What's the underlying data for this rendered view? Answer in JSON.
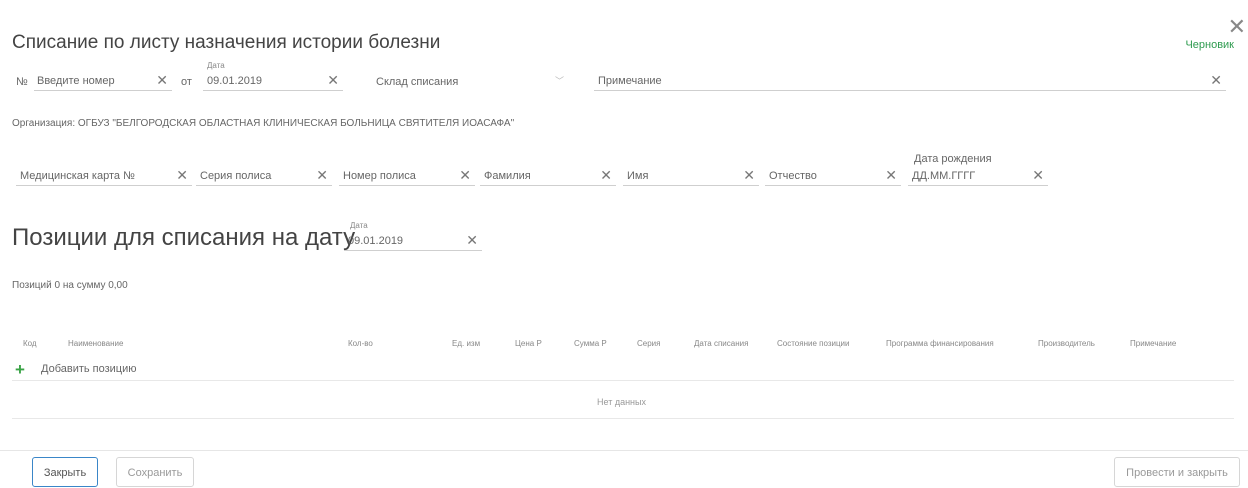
{
  "header": {
    "title": "Списание по листу назначения истории болезни",
    "status": "Черновик",
    "close_symbol": "✕"
  },
  "top_fields": {
    "number_prefix": "№",
    "number_placeholder": "Введите номер",
    "date_prefix": "от",
    "date_label": "Дата",
    "date_value": "09.01.2019",
    "warehouse_placeholder": "Склад списания",
    "note_placeholder": "Примечание",
    "clear_symbol": "✕"
  },
  "organization": "Организация: ОГБУЗ \"БЕЛГОРОДСКАЯ ОБЛАСТНАЯ КЛИНИЧЕСКАЯ БОЛЬНИЦА СВЯТИТЕЛЯ ИОАСАФА\"",
  "patient_fields": {
    "card": "Медицинская карта №",
    "policy_series": "Серия полиса",
    "policy_number": "Номер полиса",
    "last_name": "Фамилия",
    "first_name": "Имя",
    "middle_name": "Отчество",
    "birth_label": "Дата рождения",
    "birth_placeholder": "ДД.ММ.ГГГГ"
  },
  "positions": {
    "title": "Позиции для списания на дату",
    "date_label": "Дата",
    "date_value": "09.01.2019",
    "summary": "Позиций 0 на сумму 0,00",
    "add_label": "Добавить позицию",
    "empty_text": "Нет данных",
    "columns": [
      "Код",
      "Наименование",
      "Кол-во",
      "Ед. изм",
      "Цена Р",
      "Сумма Р",
      "Серия",
      "Дата списания",
      "Состояние позиции",
      "Программа финансирования",
      "Производитель",
      "Примечание"
    ]
  },
  "footer": {
    "close": "Закрыть",
    "save": "Сохранить",
    "submit": "Провести и закрыть"
  },
  "colors": {
    "status": "#2e9b4f",
    "primary_border": "#3a86c8",
    "add_icon": "#3aa346"
  }
}
